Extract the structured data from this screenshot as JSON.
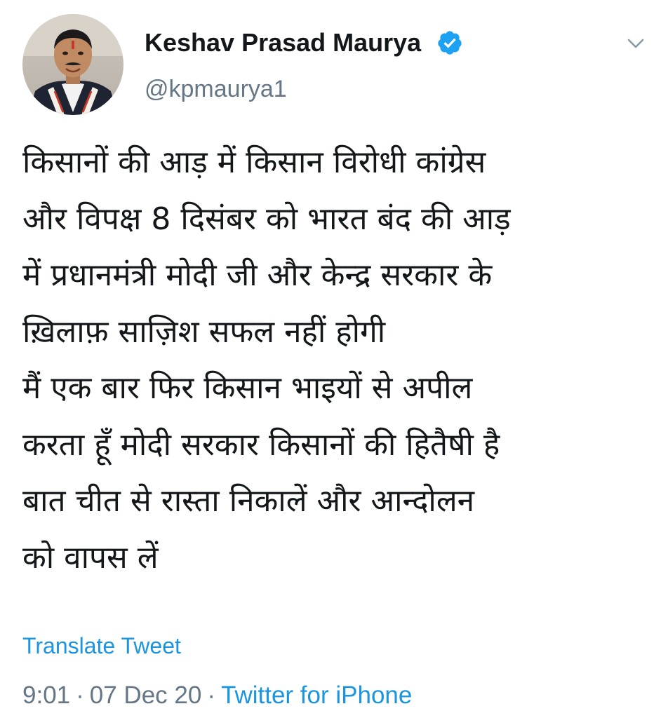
{
  "author": {
    "display_name": "Keshav Prasad Maurya",
    "handle": "@kpmaurya1",
    "verified": true
  },
  "tweet": {
    "lines": [
      "किसानों की आड़ में किसान विरोधी कांग्रेस",
      "और विपक्ष 8 दिसंबर को भारत बंद की आड़",
      "में प्रधानमंत्री मोदी जी और केन्द्र सरकार के",
      "ख़िलाफ़ साज़िश सफल नहीं होगी",
      "मैं एक बार फिर किसान भाइयों से अपील",
      "करता हूँ मोदी सरकार किसानों की हितैषी है",
      "बात चीत से रास्ता निकालें और आन्दोलन",
      "को वापस लें"
    ],
    "translate_label": "Translate Tweet"
  },
  "meta": {
    "time": "9:01",
    "separator": "·",
    "date": "07 Dec 20",
    "source": "Twitter for iPhone"
  },
  "colors": {
    "accent": "#1b95e0",
    "secondary_text": "#657786",
    "primary_text": "#14171a",
    "verified_badge": "#1da1f2"
  },
  "icons": {
    "verified": "verified-badge-icon",
    "menu": "chevron-down-icon"
  }
}
